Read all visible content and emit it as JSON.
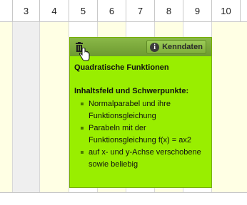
{
  "timeline": {
    "columns": [
      "3",
      "4",
      "5",
      "6",
      "7",
      "8",
      "9",
      "10"
    ]
  },
  "card": {
    "keydata_label": "Kenndaten",
    "title": "Quadratische Funktionen",
    "section_heading": "Inhaltsfeld und Schwerpunkte:",
    "items": [
      "Normalparabel und ihre Funktionsgleichung",
      "Parabeln mit der Funktionsgleichung f(x) = ax2",
      "auf x- und y-Achse verschobene sowie beliebig"
    ],
    "colors": {
      "card_background": "#99ee00",
      "toolbar": "#7aa83a"
    },
    "icons": [
      "trash-icon",
      "info-icon",
      "hand-cursor-icon"
    ]
  }
}
